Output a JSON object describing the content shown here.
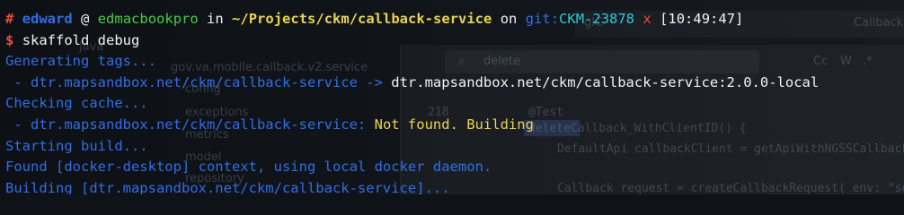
{
  "prompt": {
    "user": "edward",
    "at": "@",
    "host": "edmacbookpro",
    "in": "in",
    "path": "~/Projects/ckm/callback-service",
    "on": "on",
    "git_prefix": "git:",
    "branch": "CKM-23878",
    "dirty_mark": "x",
    "time": "[10:49:47]"
  },
  "command": {
    "symbol": "$",
    "text": "skaffold debug"
  },
  "output": {
    "l1": "Generating tags...",
    "l2_image": " - dtr.mapsandbox.net/ckm/callback-service -> ",
    "l2_tag": "dtr.mapsandbox.net/ckm/callback-service:2.0.0-local",
    "l3": "Checking cache...",
    "l4_image": " - dtr.mapsandbox.net/ckm/callback-service: ",
    "l4_status": "Not found. Building",
    "l5": "Starting build...",
    "l6": "Found [docker-desktop] context, using local docker daemon.",
    "l7": "Building [dtr.mapsandbox.net/ckm/callback-service]..."
  },
  "background_ide": {
    "tree": [
      "java",
      "gov.va.mobile.callback.v2.service",
      "config",
      "exceptions",
      "metrics",
      "model",
      "repository"
    ],
    "search_query": "delete",
    "search_options": [
      "Cc",
      "W",
      ".*"
    ],
    "tab_label": "CallbackS",
    "tab_left_fragment": "gIC",
    "line_number": "218",
    "annotation": "@Test",
    "method": "deleteCallback_WithClientID() {",
    "code1": "DefaultApi callbackClient = getApiWithNGSSCallback",
    "code2": "Callback request = createCallbackRequest( env: \"sq\""
  },
  "colors": {
    "background": "#0f1216",
    "green": "#3fd23f",
    "yellow": "#e8d44d",
    "blue": "#2f6ee8",
    "cyan": "#2fc9d6",
    "red": "#f0483a",
    "white": "#f2f2f2"
  }
}
